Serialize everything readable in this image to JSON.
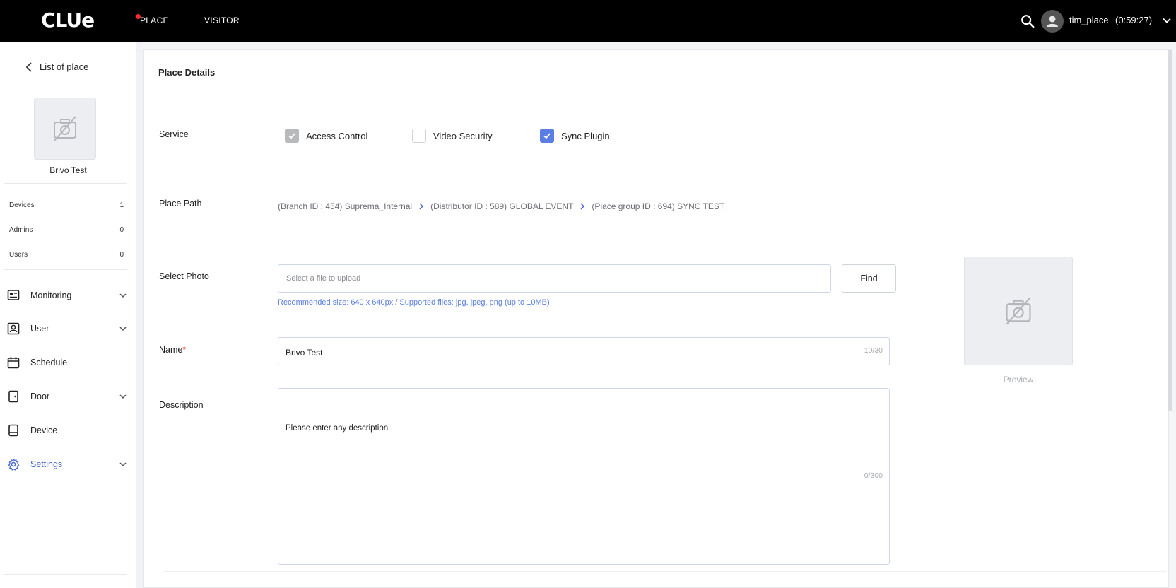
{
  "topbar": {
    "logo": "CLUe",
    "nav": [
      {
        "label": "PLACE",
        "active": true
      },
      {
        "label": "VISITOR",
        "active": false
      }
    ],
    "user_name": "tim_place",
    "session_time": "(0:59:27)"
  },
  "sidebar": {
    "back_label": "List of place",
    "place_name": "Brivo Test",
    "stats": [
      {
        "label": "Devices",
        "value": "1"
      },
      {
        "label": "Admins",
        "value": "0"
      },
      {
        "label": "Users",
        "value": "0"
      }
    ],
    "menu": [
      {
        "label": "Monitoring",
        "icon": "monitoring-icon",
        "expandable": true
      },
      {
        "label": "User",
        "icon": "user-icon",
        "expandable": true
      },
      {
        "label": "Schedule",
        "icon": "calendar-icon",
        "expandable": false
      },
      {
        "label": "Door",
        "icon": "door-icon",
        "expandable": true
      },
      {
        "label": "Device",
        "icon": "device-icon",
        "expandable": false
      },
      {
        "label": "Settings",
        "icon": "gear-icon",
        "expandable": true,
        "active": true
      }
    ]
  },
  "main": {
    "title": "Place Details",
    "service": {
      "label": "Service",
      "options": [
        {
          "label": "Access Control",
          "checked": true,
          "disabled": true
        },
        {
          "label": "Video Security",
          "checked": false,
          "disabled": false
        },
        {
          "label": "Sync Plugin",
          "checked": true,
          "disabled": false
        }
      ]
    },
    "place_path": {
      "label": "Place Path",
      "segments": [
        "(Branch ID : 454) Suprema_Internal",
        "(Distributor ID : 589) GLOBAL EVENT",
        "(Place group ID : 694) SYNC TEST"
      ]
    },
    "photo": {
      "label": "Select Photo",
      "placeholder": "Select a file to upload",
      "find_label": "Find",
      "hint": "Recommended size: 640 x 640px / Supported files: jpg, jpeg, png (up to 10MB)",
      "preview_label": "Preview"
    },
    "name": {
      "label": "Name",
      "required_mark": "*",
      "value": "Brivo Test",
      "counter": "10/30"
    },
    "description": {
      "label": "Description",
      "placeholder": "Please enter any description.",
      "counter": "0/300"
    }
  },
  "colors": {
    "accent": "#5b7ee5",
    "topbar": "#000000",
    "active_dot": "#ff2a2a"
  }
}
